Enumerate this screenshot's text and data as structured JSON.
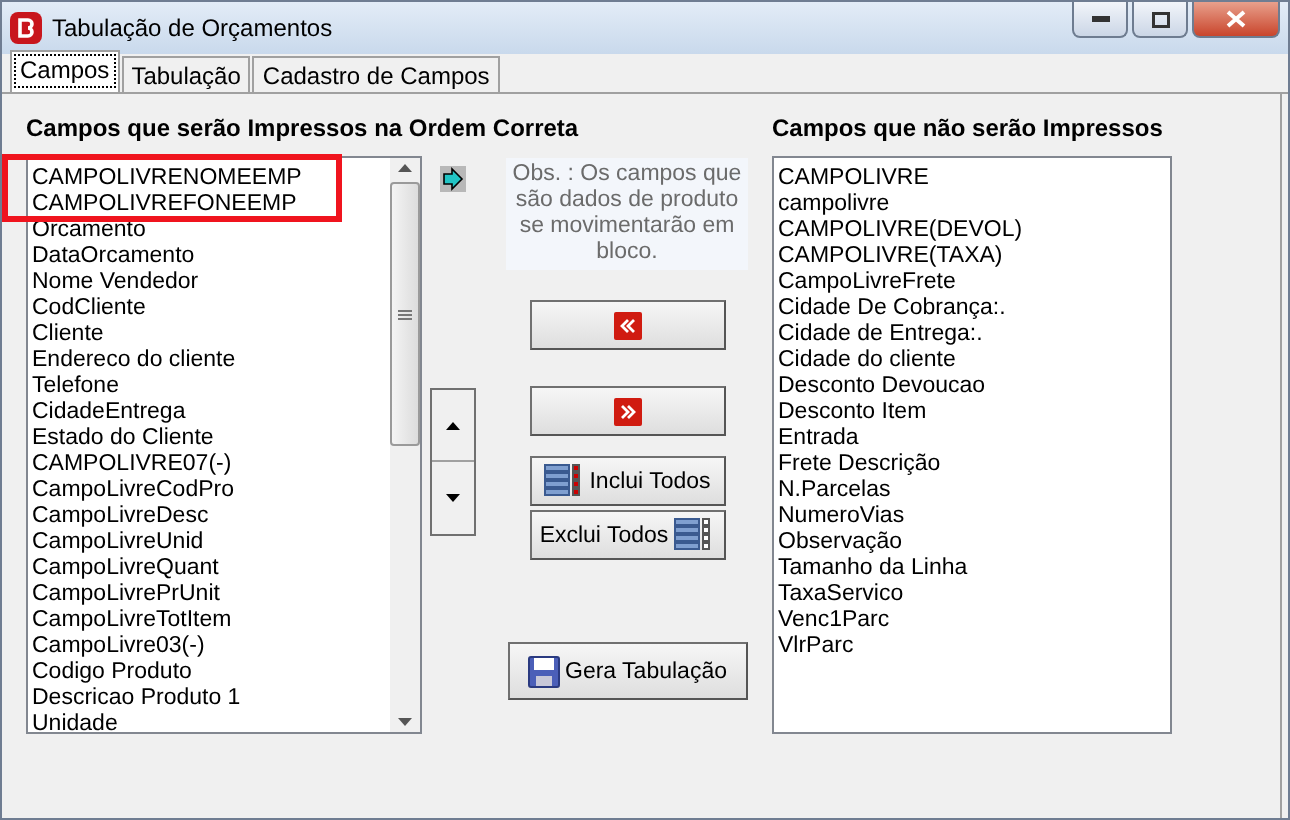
{
  "window": {
    "title": "Tabulação de Orçamentos"
  },
  "tabs": [
    {
      "label": "Campos",
      "selected": true
    },
    {
      "label": "Tabulação",
      "selected": false
    },
    {
      "label": "Cadastro de Campos",
      "selected": false
    }
  ],
  "printed": {
    "heading": "Campos que serão Impressos na Ordem Correta",
    "items": [
      "CAMPOLIVRENOMEEMP",
      "CAMPOLIVREFONEEMP",
      "Orcamento",
      "DataOrcamento",
      "Nome Vendedor",
      "CodCliente",
      "Cliente",
      "Endereco do cliente",
      "Telefone",
      "CidadeEntrega",
      "Estado do Cliente",
      "CAMPOLIVRE07(-)",
      "CampoLivreCodPro",
      "CampoLivreDesc",
      "CampoLivreUnid",
      "CampoLivreQuant",
      "CampoLivrePrUnit",
      "CampoLivreTotItem",
      "CampoLivre03(-)",
      "Codigo Produto",
      "Descricao Produto 1",
      "Unidade"
    ]
  },
  "not_printed": {
    "heading": "Campos que não serão Impressos",
    "items": [
      "CAMPOLIVRE",
      "campolivre",
      "CAMPOLIVRE(DEVOL)",
      "CAMPOLIVRE(TAXA)",
      "CampoLivreFrete",
      "Cidade De Cobrança:.",
      "Cidade de Entrega:.",
      "Cidade do cliente",
      "Desconto Devoucao",
      "Desconto Item",
      "Entrada",
      "Frete Descrição",
      "N.Parcelas",
      "NumeroVias",
      "Observação",
      "Tamanho da Linha",
      "TaxaServico",
      "Venc1Parc",
      "VlrParc"
    ]
  },
  "note": "Obs. : Os campos que são dados de produto se  movimentarão em bloco.",
  "buttons": {
    "include_all": "Inclui Todos",
    "exclude_all": "Exclui Todos",
    "generate": "Gera Tabulação"
  }
}
